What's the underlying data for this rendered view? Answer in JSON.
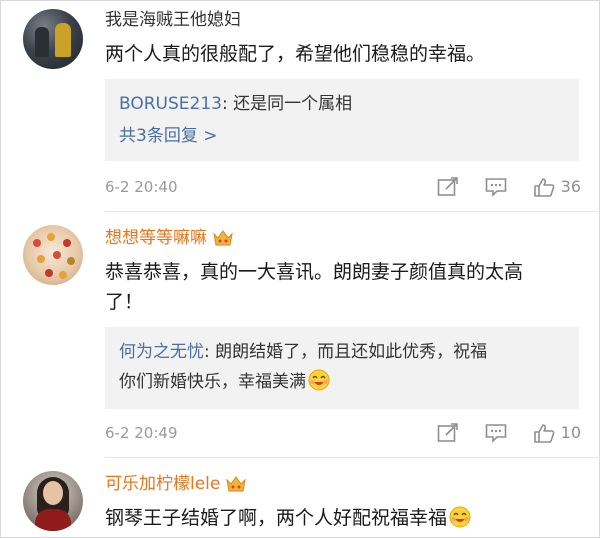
{
  "comments": [
    {
      "name": "我是海贼王他媳妇",
      "text": "两个人真的很般配了，希望他们稳稳的幸福。",
      "reply": {
        "user": "BORUSE213",
        "text": ": 还是同一个属相"
      },
      "more_replies": "共3条回复 >",
      "time": "6-2 20:40",
      "likes": "36"
    },
    {
      "name": "想想等等嘛嘛",
      "text_line1": "恭喜恭喜，真的一大喜讯。朗朗妻子颜值真的太高",
      "text_line2": "了！",
      "reply": {
        "user": "何为之无忧",
        "text_line1": ": 朗朗结婚了，而且还如此优秀，祝福",
        "text_line2": "你们新婚快乐，幸福美满"
      },
      "time": "6-2 20:49",
      "likes": "10"
    },
    {
      "name": "可乐加柠檬lele",
      "text": "钢琴王子结婚了啊，两个人好配祝福幸福"
    }
  ],
  "colors": {
    "vip_name": "#e8751a",
    "reply_user": "#4a6fa5",
    "meta": "#9a9a9a"
  },
  "icons": [
    "share-icon",
    "comment-icon",
    "like-icon",
    "crown-icon",
    "smile-emoji"
  ]
}
